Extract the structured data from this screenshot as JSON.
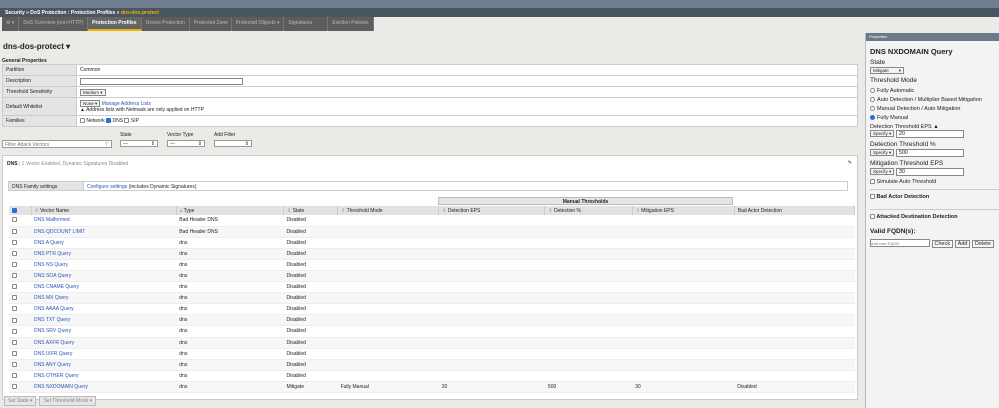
{
  "breadcrumb": {
    "a": "Security",
    "sep": " » ",
    "b": "DoS Protection : Protection Profiles",
    "c": "dns-dos-protect"
  },
  "tabs": [
    "DoS Overview (non-HTTP)",
    "Protection Profiles",
    "Device Protection",
    "Protected Zone",
    "Protected Objects ▾",
    "Signatures",
    "Eviction Policies"
  ],
  "profile_title": "dns-dos-protect ▾",
  "general": {
    "heading": "General Properties",
    "partition_label": "Partition",
    "partition": "Common",
    "description_label": "Description",
    "description": "",
    "threshold_label": "Threshold Sensitivity",
    "threshold": "Medium",
    "whitelist_label": "Default Whitelist",
    "whitelist": "None",
    "manage": "Manage Address Lists",
    "warning": "Address lists with Netmask are only applied on HTTP",
    "families_label": "Families",
    "fam_network": "Network",
    "fam_dns": "DNS",
    "fam_sip": "SIP"
  },
  "filters": {
    "placeholder": "Filter Attack Vectors",
    "state_label": "State",
    "state": "---",
    "type_label": "Vector Type",
    "type": "---",
    "add_label": "Add Filter",
    "add": ""
  },
  "dns": {
    "name": "DNS",
    "summary": "1 Vector Enabled, Dynamic Signatures Disabled",
    "family_label": "DNS Family settings",
    "configure": "Configure settings",
    "configure_note": " (includes Dynamic Signatures)",
    "manual_thresholds": "Manual Thresholds",
    "columns": [
      "Vector Name",
      "Type",
      "State",
      "Threshold Mode",
      "Detection EPS",
      "Detection %",
      "Mitigation EPS",
      "Bad Actor Detection"
    ],
    "rows": [
      [
        "DNS Malformed",
        "Bad Header DNS",
        "Disabled",
        "",
        "",
        "",
        "",
        ""
      ],
      [
        "DNS QDCOUNT LIMIT",
        "Bad Header DNS",
        "Disabled",
        "",
        "",
        "",
        "",
        ""
      ],
      [
        "DNS A Query",
        "dns",
        "Disabled",
        "",
        "",
        "",
        "",
        ""
      ],
      [
        "DNS PTR Query",
        "dns",
        "Disabled",
        "",
        "",
        "",
        "",
        ""
      ],
      [
        "DNS NS Query",
        "dns",
        "Disabled",
        "",
        "",
        "",
        "",
        ""
      ],
      [
        "DNS SOA Query",
        "dns",
        "Disabled",
        "",
        "",
        "",
        "",
        ""
      ],
      [
        "DNS CNAME Query",
        "dns",
        "Disabled",
        "",
        "",
        "",
        "",
        ""
      ],
      [
        "DNS MX Query",
        "dns",
        "Disabled",
        "",
        "",
        "",
        "",
        ""
      ],
      [
        "DNS AAAA Query",
        "dns",
        "Disabled",
        "",
        "",
        "",
        "",
        ""
      ],
      [
        "DNS TXT Query",
        "dns",
        "Disabled",
        "",
        "",
        "",
        "",
        ""
      ],
      [
        "DNS SRV Query",
        "dns",
        "Disabled",
        "",
        "",
        "",
        "",
        ""
      ],
      [
        "DNS AXFR Query",
        "dns",
        "Disabled",
        "",
        "",
        "",
        "",
        ""
      ],
      [
        "DNS IXFR Query",
        "dns",
        "Disabled",
        "",
        "",
        "",
        "",
        ""
      ],
      [
        "DNS ANY Query",
        "dns",
        "Disabled",
        "",
        "",
        "",
        "",
        ""
      ],
      [
        "DNS OTHER Query",
        "dns",
        "Disabled",
        "",
        "",
        "",
        "",
        ""
      ],
      [
        "DNS NXDOMAIN Query",
        "dns",
        "Mitigate",
        "Fully Manual",
        "20",
        "500",
        "30",
        "Disabled"
      ]
    ]
  },
  "bottom": {
    "set_state": "Set State ▾",
    "set_mode": "Set Threshold Mode ▾"
  },
  "panel": {
    "header": "Properties",
    "title": "DNS NXDOMAIN Query",
    "state_label": "State",
    "state": "Mitigate",
    "mode_label": "Threshold Mode",
    "modes": [
      "Fully Automatic",
      "Auto Detection / Multiplier Based Mitigation",
      "Manual Detection / Auto Mitigation",
      "Fully Manual"
    ],
    "det_eps_label": "Detection Threshold EPS",
    "det_eps": "20",
    "det_pct_label": "Detection Threshold %",
    "det_pct": "500",
    "mit_eps_label": "Mitigation Threshold EPS",
    "mit_eps": "30",
    "specify": "Specify",
    "simulate": "Simulate Auto Threshold",
    "bad_actor": "Bad Actor Detection",
    "attacked": "Attacked Destination Detection",
    "fqdn_label": "Valid FQDN(s):",
    "fqdn_placeholder": "Add new FQDN",
    "check": "Check",
    "add": "Add",
    "delete": "Delete"
  }
}
